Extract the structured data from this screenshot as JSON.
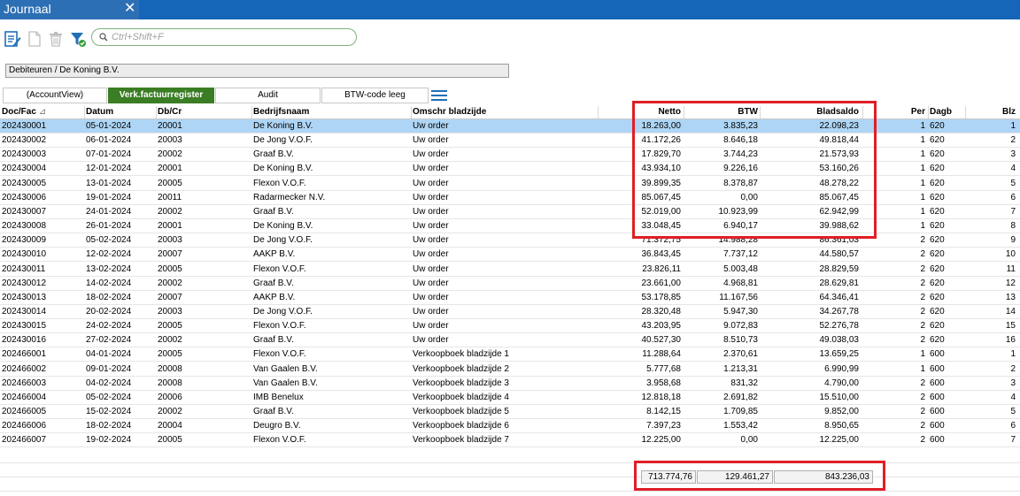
{
  "window": {
    "tab_title": "Journaal",
    "close_glyph": "✕"
  },
  "toolbar": {
    "icons": [
      "edit-document-icon",
      "new-document-icon",
      "delete-trash-icon",
      "filter-funnel-icon"
    ],
    "search_placeholder": "Ctrl+Shift+F"
  },
  "breadcrumb": "Debiteuren / De Koning B.V.",
  "tabs": [
    {
      "label": "(AccountView)",
      "active": false
    },
    {
      "label": "Verk.factuurregister",
      "active": true
    },
    {
      "label": "Audit",
      "active": false
    },
    {
      "label": "BTW-code leeg",
      "active": false
    }
  ],
  "columns": {
    "doc": "Doc/Fac",
    "sort_indicator": "⊿",
    "datum": "Datum",
    "dbcr": "Db/Cr",
    "bedrijf": "Bedrijfsnaam",
    "omschr": "Omschr bladzijde",
    "netto": "Netto",
    "btw": "BTW",
    "saldo": "Bladsaldo",
    "per": "Per",
    "dagb": "Dagb",
    "blz": "Blz"
  },
  "rows": [
    [
      "202430001",
      "05-01-2024",
      "20001",
      "De Koning B.V.",
      "Uw order",
      "18.263,00",
      "3.835,23",
      "22.098,23",
      "1",
      "620",
      "1"
    ],
    [
      "202430002",
      "06-01-2024",
      "20003",
      "De Jong V.O.F.",
      "Uw order",
      "41.172,26",
      "8.646,18",
      "49.818,44",
      "1",
      "620",
      "2"
    ],
    [
      "202430003",
      "07-01-2024",
      "20002",
      "Graaf B.V.",
      "Uw order",
      "17.829,70",
      "3.744,23",
      "21.573,93",
      "1",
      "620",
      "3"
    ],
    [
      "202430004",
      "12-01-2024",
      "20001",
      "De Koning B.V.",
      "Uw order",
      "43.934,10",
      "9.226,16",
      "53.160,26",
      "1",
      "620",
      "4"
    ],
    [
      "202430005",
      "13-01-2024",
      "20005",
      "Flexon V.O.F.",
      "Uw order",
      "39.899,35",
      "8.378,87",
      "48.278,22",
      "1",
      "620",
      "5"
    ],
    [
      "202430006",
      "19-01-2024",
      "20011",
      "Radarmecker N.V.",
      "Uw order",
      "85.067,45",
      "0,00",
      "85.067,45",
      "1",
      "620",
      "6"
    ],
    [
      "202430007",
      "24-01-2024",
      "20002",
      "Graaf B.V.",
      "Uw order",
      "52.019,00",
      "10.923,99",
      "62.942,99",
      "1",
      "620",
      "7"
    ],
    [
      "202430008",
      "26-01-2024",
      "20001",
      "De Koning B.V.",
      "Uw order",
      "33.048,45",
      "6.940,17",
      "39.988,62",
      "1",
      "620",
      "8"
    ],
    [
      "202430009",
      "05-02-2024",
      "20003",
      "De Jong V.O.F.",
      "Uw order",
      "71.372,75",
      "14.988,28",
      "86.361,03",
      "2",
      "620",
      "9"
    ],
    [
      "202430010",
      "12-02-2024",
      "20007",
      "AAKP B.V.",
      "Uw order",
      "36.843,45",
      "7.737,12",
      "44.580,57",
      "2",
      "620",
      "10"
    ],
    [
      "202430011",
      "13-02-2024",
      "20005",
      "Flexon V.O.F.",
      "Uw order",
      "23.826,11",
      "5.003,48",
      "28.829,59",
      "2",
      "620",
      "11"
    ],
    [
      "202430012",
      "14-02-2024",
      "20002",
      "Graaf B.V.",
      "Uw order",
      "23.661,00",
      "4.968,81",
      "28.629,81",
      "2",
      "620",
      "12"
    ],
    [
      "202430013",
      "18-02-2024",
      "20007",
      "AAKP B.V.",
      "Uw order",
      "53.178,85",
      "11.167,56",
      "64.346,41",
      "2",
      "620",
      "13"
    ],
    [
      "202430014",
      "20-02-2024",
      "20003",
      "De Jong V.O.F.",
      "Uw order",
      "28.320,48",
      "5.947,30",
      "34.267,78",
      "2",
      "620",
      "14"
    ],
    [
      "202430015",
      "24-02-2024",
      "20005",
      "Flexon V.O.F.",
      "Uw order",
      "43.203,95",
      "9.072,83",
      "52.276,78",
      "2",
      "620",
      "15"
    ],
    [
      "202430016",
      "27-02-2024",
      "20002",
      "Graaf B.V.",
      "Uw order",
      "40.527,30",
      "8.510,73",
      "49.038,03",
      "2",
      "620",
      "16"
    ],
    [
      "202466001",
      "04-01-2024",
      "20005",
      "Flexon V.O.F.",
      "Verkoopboek bladzijde 1",
      "11.288,64",
      "2.370,61",
      "13.659,25",
      "1",
      "600",
      "1"
    ],
    [
      "202466002",
      "09-01-2024",
      "20008",
      "Van Gaalen B.V.",
      "Verkoopboek bladzijde 2",
      "5.777,68",
      "1.213,31",
      "6.990,99",
      "1",
      "600",
      "2"
    ],
    [
      "202466003",
      "04-02-2024",
      "20008",
      "Van Gaalen B.V.",
      "Verkoopboek bladzijde 3",
      "3.958,68",
      "831,32",
      "4.790,00",
      "2",
      "600",
      "3"
    ],
    [
      "202466004",
      "05-02-2024",
      "20006",
      "IMB Benelux",
      "Verkoopboek bladzijde 4",
      "12.818,18",
      "2.691,82",
      "15.510,00",
      "2",
      "600",
      "4"
    ],
    [
      "202466005",
      "15-02-2024",
      "20002",
      "Graaf B.V.",
      "Verkoopboek bladzijde 5",
      "8.142,15",
      "1.709,85",
      "9.852,00",
      "2",
      "600",
      "5"
    ],
    [
      "202466006",
      "18-02-2024",
      "20004",
      "Deugro B.V.",
      "Verkoopboek bladzijde 6",
      "7.397,23",
      "1.553,42",
      "8.950,65",
      "2",
      "600",
      "6"
    ],
    [
      "202466007",
      "19-02-2024",
      "20005",
      "Flexon V.O.F.",
      "Verkoopboek bladzijde 7",
      "12.225,00",
      "0,00",
      "12.225,00",
      "2",
      "600",
      "7"
    ]
  ],
  "selected_row": 0,
  "totals": {
    "netto": "713.774,76",
    "btw": "129.461,27",
    "saldo": "843.236,03"
  },
  "colors": {
    "accent_blue": "#1565b8",
    "active_tab_green": "#3a7d24",
    "selection": "#aed5f5",
    "highlight_red": "#e01e26"
  }
}
